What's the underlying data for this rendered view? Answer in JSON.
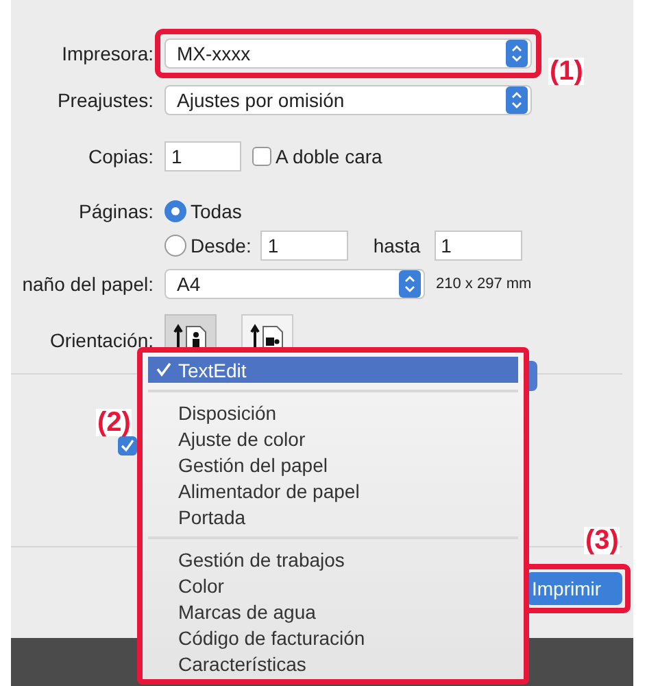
{
  "printer": {
    "label": "Impresora:",
    "value": "MX-xxxx",
    "highlighted": true
  },
  "presets": {
    "label": "Preajustes:",
    "value": "Ajustes por omisión"
  },
  "copies": {
    "label": "Copias:",
    "value": "1",
    "duplex_label": "A doble cara",
    "duplex_checked": false
  },
  "pages": {
    "label": "Páginas:",
    "options": [
      {
        "label": "Todas",
        "selected": true
      },
      {
        "label": "Desde:",
        "selected": false
      }
    ],
    "from": "1",
    "to_label": "hasta",
    "to": "1"
  },
  "paper_size": {
    "label": "naño del papel:",
    "value": "A4",
    "dimensions": "210 x 297 mm"
  },
  "orientation": {
    "label": "Orientación:",
    "options": [
      {
        "kind": "portrait",
        "selected": true
      },
      {
        "kind": "landscape",
        "selected": false
      }
    ]
  },
  "option_checkbox": {
    "checked": true
  },
  "menu": {
    "highlighted": true,
    "groups": [
      [
        {
          "label": "TextEdit",
          "selected": true
        }
      ],
      [
        {
          "label": "Disposición",
          "selected": false
        },
        {
          "label": "Ajuste de color",
          "selected": false
        },
        {
          "label": "Gestión del papel",
          "selected": false
        },
        {
          "label": "Alimentador de papel",
          "selected": false
        },
        {
          "label": "Portada",
          "selected": false
        }
      ],
      [
        {
          "label": "Gestión de trabajos",
          "selected": false
        },
        {
          "label": "Color",
          "selected": false
        },
        {
          "label": "Marcas de agua",
          "selected": false
        },
        {
          "label": "Código de facturación",
          "selected": false
        },
        {
          "label": "Características",
          "selected": false
        }
      ]
    ]
  },
  "print_button": {
    "label": "Imprimir",
    "highlighted": true
  },
  "callouts": [
    {
      "label": "(1)"
    },
    {
      "label": "(2)"
    },
    {
      "label": "(3)"
    }
  ]
}
